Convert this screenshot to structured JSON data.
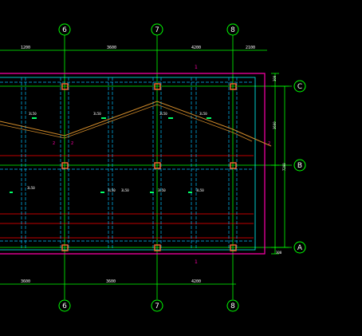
{
  "drawing": {
    "colors": {
      "background": "#000000",
      "gridline": "#00ff00",
      "outline": "#ff00aa",
      "inner_outline": "#00ffff",
      "dashed_beam": "#00bfff",
      "red_line": "#ff0000",
      "roof_line": "#d08a2a",
      "column": "#ff6633",
      "text": "#ffffff",
      "tag": "#00ff66"
    },
    "vertical_axes": [
      "6",
      "7",
      "8"
    ],
    "horizontal_axes": [
      "C",
      "B",
      "A"
    ],
    "top_dims": [
      "1200",
      "3600",
      "4200",
      "2100"
    ],
    "bottom_dims": [
      "3600",
      "3600",
      "4200"
    ],
    "right_dims": [
      "300",
      "3600",
      "7200",
      "300"
    ],
    "section_marks": [
      "1",
      "1"
    ],
    "side_marks": [
      "2",
      "2",
      "2"
    ],
    "beam_labels_upper": [
      "3L50",
      "3L50",
      "3L50",
      "3L50"
    ],
    "beam_labels_lower": [
      "3L50",
      "3L50",
      "3L50",
      "3L50",
      "3L50"
    ]
  }
}
